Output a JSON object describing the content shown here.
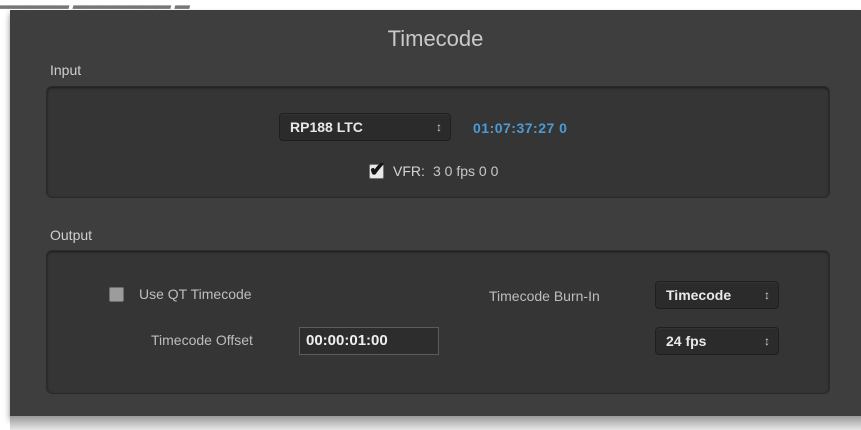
{
  "window": {
    "title": "Timecode"
  },
  "input": {
    "section_label": "Input",
    "source_select": {
      "value": "RP188  LTC",
      "arrow_icon": "up-down-chevron"
    },
    "timecode_readout": "01:07:37:27  0",
    "vfr": {
      "checked": true,
      "label": "VFR:",
      "value": "3 0 fps  0 0"
    }
  },
  "output": {
    "section_label": "Output",
    "use_qt_timecode": {
      "checked": false,
      "label": "Use QT Timecode"
    },
    "timecode_offset": {
      "label": "Timecode Offset",
      "value": "00:00:01:00"
    },
    "burn_in": {
      "label": "Timecode Burn-In",
      "mode_select": {
        "value": "Timecode"
      },
      "fps_select": {
        "value": "24 fps"
      }
    }
  },
  "colors": {
    "panel_bg": "#3e3e3e",
    "accent_timecode": "#4d9ad4"
  }
}
